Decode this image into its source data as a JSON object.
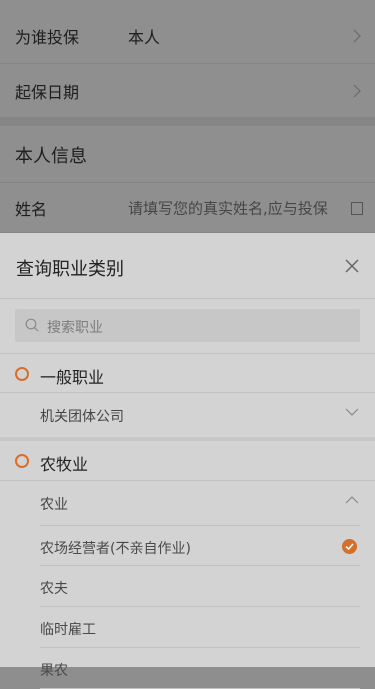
{
  "form": {
    "rows": [
      {
        "label": "为谁投保",
        "value": "本人"
      },
      {
        "label": "起保日期",
        "value": ""
      }
    ],
    "section_title": "本人信息",
    "name_label": "姓名",
    "name_placeholder": "请填写您的真实姓名,应与投保"
  },
  "sheet": {
    "title": "查询职业类别",
    "search_placeholder": "搜索职业",
    "categories": [
      {
        "name": "一般职业",
        "subcategories": [
          {
            "name": "机关团体公司",
            "expanded": false
          }
        ]
      },
      {
        "name": "农牧业",
        "subcategories": [
          {
            "name": "农业",
            "expanded": true
          }
        ]
      }
    ],
    "items": [
      {
        "name": "农场经营者(不亲自作业)",
        "selected": true
      },
      {
        "name": "农夫",
        "selected": false
      },
      {
        "name": "临时雇工",
        "selected": false
      },
      {
        "name": "果农",
        "selected": false
      }
    ]
  },
  "colors": {
    "accent": "#d5702c"
  }
}
